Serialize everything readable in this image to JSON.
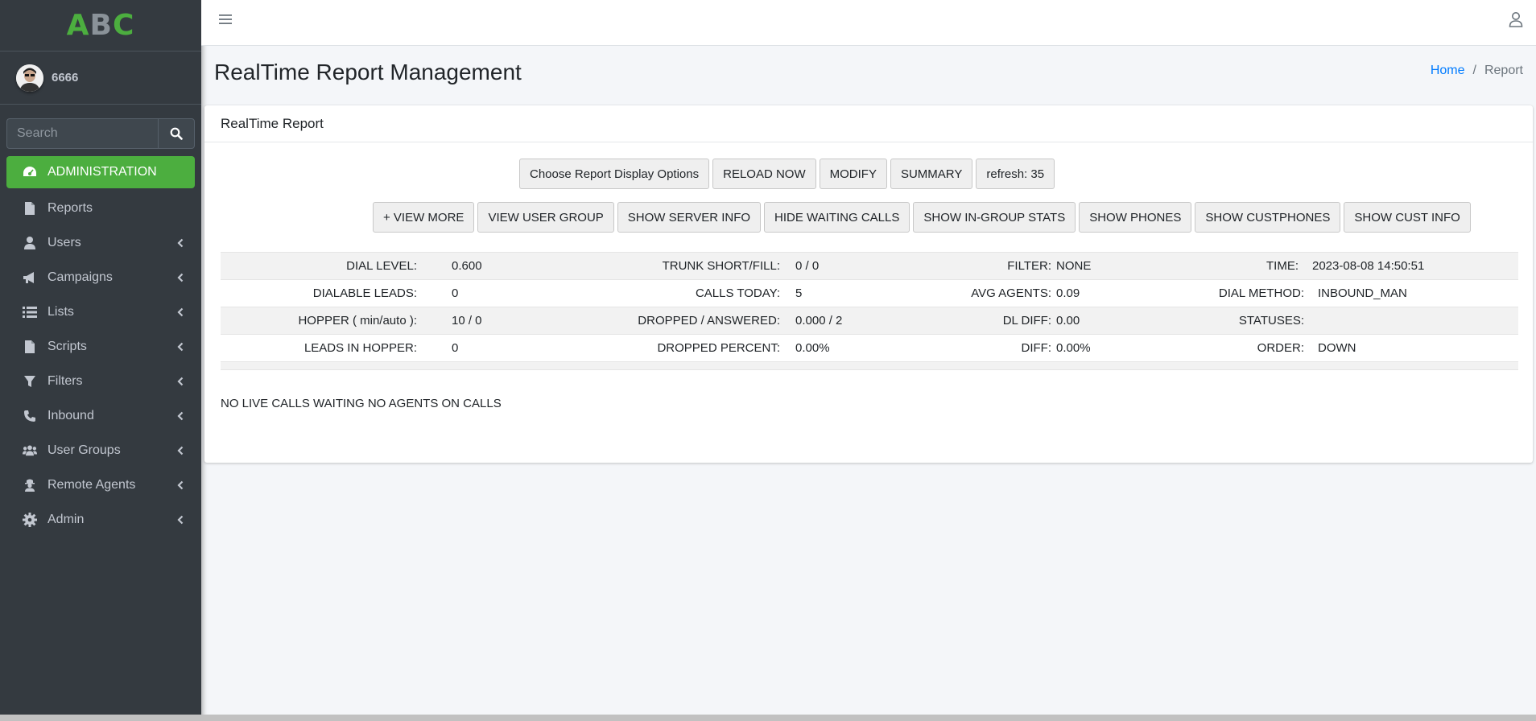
{
  "brand": {
    "a": "A",
    "b": "B",
    "c": "C"
  },
  "user": {
    "name": "6666"
  },
  "search": {
    "placeholder": "Search"
  },
  "nav": [
    {
      "label": "ADMINISTRATION",
      "icon": "dashboard-icon",
      "active": true
    },
    {
      "label": "Reports",
      "icon": "file-icon"
    },
    {
      "label": "Users",
      "icon": "user-icon"
    },
    {
      "label": "Campaigns",
      "icon": "bullhorn-icon"
    },
    {
      "label": "Lists",
      "icon": "list-icon"
    },
    {
      "label": "Scripts",
      "icon": "file-icon"
    },
    {
      "label": "Filters",
      "icon": "filter-icon"
    },
    {
      "label": "Inbound",
      "icon": "phone-icon"
    },
    {
      "label": "User Groups",
      "icon": "users-icon"
    },
    {
      "label": "Remote Agents",
      "icon": "user-secret-icon"
    },
    {
      "label": "Admin",
      "icon": "gear-icon"
    }
  ],
  "page": {
    "title": "RealTime Report Management"
  },
  "breadcrumb": {
    "home": "Home",
    "sep": "/",
    "current": "Report"
  },
  "card": {
    "title": "RealTime Report"
  },
  "buttons_row1": [
    "Choose Report Display Options",
    "RELOAD NOW",
    "MODIFY",
    "SUMMARY",
    "refresh: 35"
  ],
  "buttons_row2": [
    "+ VIEW MORE",
    "VIEW USER GROUP",
    "SHOW SERVER INFO",
    "HIDE WAITING CALLS",
    "SHOW IN-GROUP STATS",
    "SHOW PHONES",
    "SHOW CUSTPHONES",
    "SHOW CUST INFO"
  ],
  "stats": [
    [
      [
        "DIAL LEVEL:",
        "0.600"
      ],
      [
        "TRUNK SHORT/FILL:",
        "0 / 0"
      ],
      [
        "FILTER:",
        "NONE"
      ],
      [
        "TIME:",
        "2023-08-08 14:50:51"
      ]
    ],
    [
      [
        "DIALABLE LEADS:",
        "0"
      ],
      [
        "CALLS TODAY:",
        "5"
      ],
      [
        "AVG AGENTS:",
        "0.09"
      ],
      [
        "DIAL METHOD:",
        "INBOUND_MAN"
      ]
    ],
    [
      [
        "HOPPER ( min/auto ):",
        "10 / 0"
      ],
      [
        "DROPPED / ANSWERED:",
        "0.000 / 2"
      ],
      [
        "DL DIFF:",
        "0.00"
      ],
      [
        "STATUSES:",
        ""
      ]
    ],
    [
      [
        "LEADS IN HOPPER:",
        "0"
      ],
      [
        "DROPPED PERCENT:",
        "0.00%"
      ],
      [
        "DIFF:",
        "0.00%"
      ],
      [
        "ORDER:",
        "DOWN"
      ]
    ]
  ],
  "status_message": "NO LIVE CALLS WAITING NO AGENTS ON CALLS",
  "colors": {
    "accent": "#4cae3f",
    "sidebar": "#343a40",
    "link": "#007bff"
  }
}
